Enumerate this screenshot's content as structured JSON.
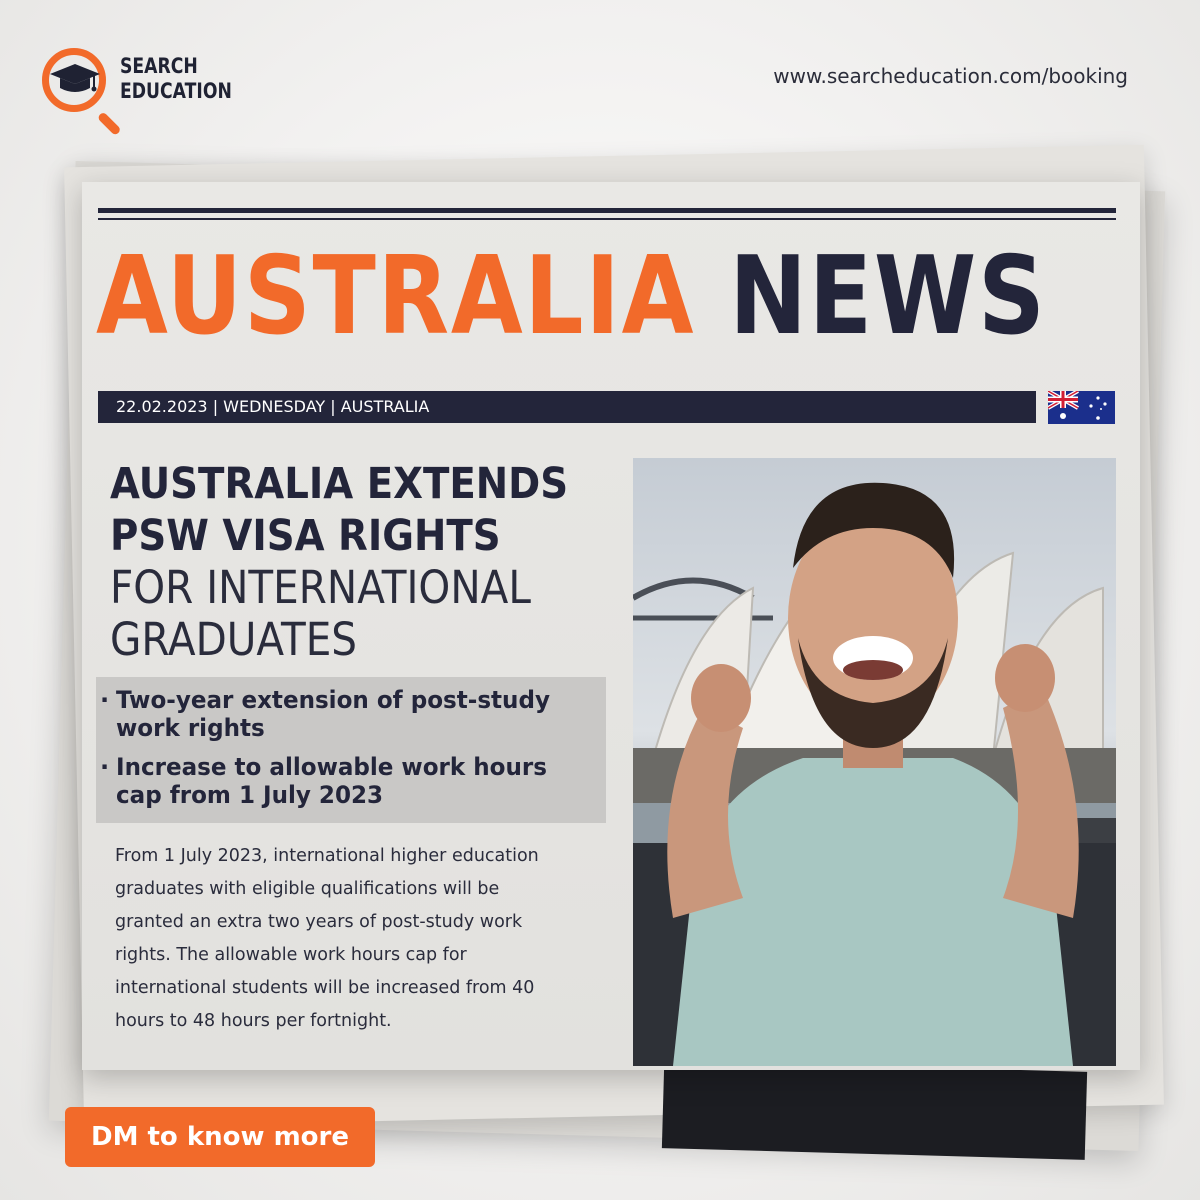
{
  "brand": {
    "line1": "SEARCH",
    "line2": "EDUCATION",
    "url": "www.searcheducation.com/booking"
  },
  "masthead": {
    "word1": "AUSTRALIA",
    "word2": "NEWS"
  },
  "dateline": "22.02.2023 | WEDNESDAY | AUSTRALIA",
  "article": {
    "headline_bold": [
      "AUSTRALIA EXTENDS",
      "PSW VISA RIGHTS"
    ],
    "headline_light": [
      "FOR INTERNATIONAL",
      "GRADUATES"
    ],
    "bullets": [
      [
        "Two-year extension of post-study",
        "work rights"
      ],
      [
        "Increase to allowable work hours",
        "cap from 1 July 2023"
      ]
    ],
    "body": [
      "From 1 July 2023, international higher education",
      "graduates with eligible qualifications will be",
      "granted an extra two years of post-study work",
      "rights. The allowable work hours cap for",
      "international students will be increased from 40",
      "hours to 48 hours per fortnight."
    ]
  },
  "cta": "DM to know more",
  "colors": {
    "accent": "#f26a2a",
    "navy": "#23253a"
  },
  "icons": {
    "logo": "magnifier-graduation-cap-icon",
    "flag": "australia-flag-icon"
  }
}
